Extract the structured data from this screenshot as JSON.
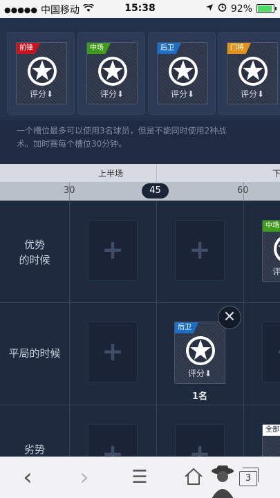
{
  "status_bar": {
    "carrier": "中国移动",
    "time": "15:38",
    "battery": "92%"
  },
  "top_slots": [
    {
      "badge": "前锋",
      "badge_color": "#c8141e",
      "rating": "评分⬇"
    },
    {
      "badge": "中场",
      "badge_color": "#3f9b1c",
      "rating": "评分⬇"
    },
    {
      "badge": "后卫",
      "badge_color": "#1d6fc6",
      "rating": "评分⬇"
    },
    {
      "badge": "门将",
      "badge_color": "#e0921a",
      "rating": "评分⬇"
    }
  ],
  "hint_line1": "一个槽位最多可以使用3名球员，但是不能同时使用2种战",
  "hint_line2": "术。加时赛每个槽位30分钟。",
  "timeline": {
    "first_half": "上半场",
    "second_half_partial": "下",
    "minutes": [
      "30",
      "45",
      "60"
    ],
    "current": "45"
  },
  "rows": [
    {
      "line1": "优势",
      "line2": "的时候"
    },
    {
      "line1": "平局的时候"
    },
    {
      "line1": "劣势"
    }
  ],
  "grid_cards": {
    "row1_partial": {
      "badge": "中场",
      "badge_color": "#3f9b1c",
      "rating": "评"
    },
    "row2_card": {
      "badge": "后卫",
      "badge_color": "#1d6fc6",
      "rating": "评分⬇",
      "count": "1名"
    },
    "row3_partial": {
      "badge": "全部",
      "badge_color": "#ffffff"
    }
  },
  "plus": "+",
  "close": "✕",
  "toolbar": {
    "back": "‹",
    "forward": "›",
    "menu": "☰",
    "tabs_count": "3"
  }
}
